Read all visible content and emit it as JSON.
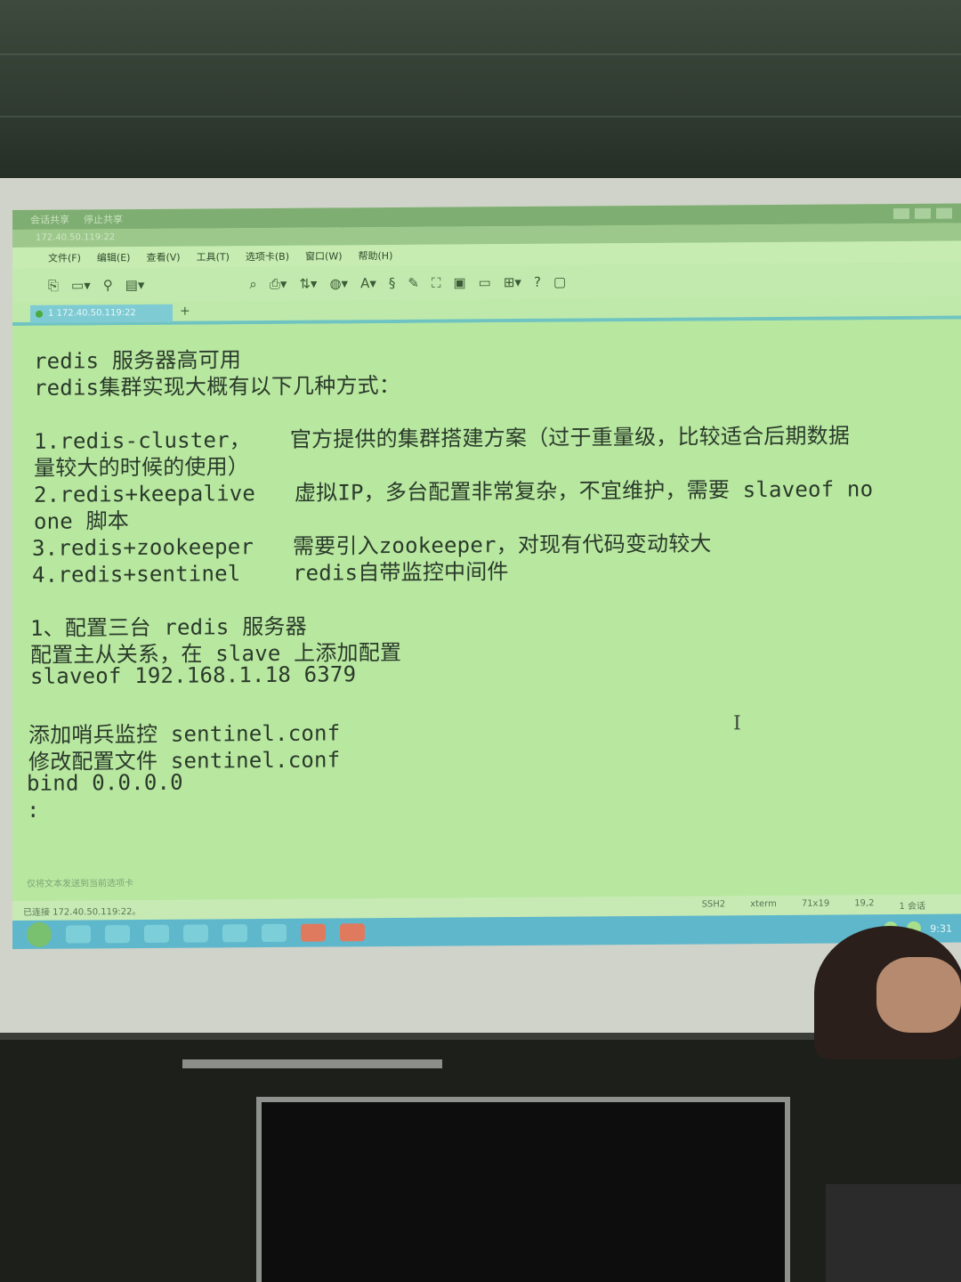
{
  "window": {
    "title_tabs": [
      "会话共享",
      "停止共享"
    ],
    "address": "172.40.50.119:22",
    "controls": [
      "minimize",
      "maximize",
      "close"
    ]
  },
  "menu": [
    "文件(F)",
    "编辑(E)",
    "查看(V)",
    "工具(T)",
    "选项卡(B)",
    "窗口(W)",
    "帮助(H)"
  ],
  "toolbar_icons": [
    "new-session-icon",
    "open-folder-icon",
    "connect-icon",
    "properties-icon",
    "search-icon",
    "print-icon",
    "transfer-icon",
    "globe-icon",
    "font-icon",
    "script-icon",
    "record-icon",
    "fullscreen-icon",
    "lock-icon",
    "keyboard-icon",
    "add-icon",
    "help-icon",
    "chat-icon"
  ],
  "tab": {
    "label": "1 172.40.50.119:22",
    "add": "+"
  },
  "terminal": {
    "lines": [
      "redis 服务器高可用",
      "redis集群实现大概有以下几种方式：",
      "",
      "1.redis-cluster，   官方提供的集群搭建方案（过于重量级，比较适合后期数据",
      "量较大的时候的使用）",
      "2.redis+keepalive   虚拟IP，多台配置非常复杂，不宜维护，需要 slaveof no",
      "one 脚本",
      "3.redis+zookeeper   需要引入zookeeper，对现有代码变动较大",
      "4.redis+sentinel    redis自带监控中间件",
      "",
      "1、配置三台 redis 服务器",
      "配置主从关系，在 slave 上添加配置",
      "slaveof 192.168.1.18 6379",
      "",
      "添加哨兵监控 sentinel.conf",
      "修改配置文件 sentinel.conf",
      "bind 0.0.0.0",
      ":"
    ],
    "send_hint": "仅将文本发送到当前选项卡"
  },
  "status": {
    "left": "已连接 172.40.50.119:22。",
    "protocol": "SSH2",
    "term": "xterm",
    "size": "71x19",
    "pos": "19,2",
    "sessions": "1 会话"
  },
  "taskbar": {
    "clock": "9:31"
  },
  "colors": {
    "terminal_bg": "#b8e7a0",
    "text": "#2a3a2a",
    "tab_accent": "#6fc4c2",
    "taskbar": "#5fb7cc"
  }
}
